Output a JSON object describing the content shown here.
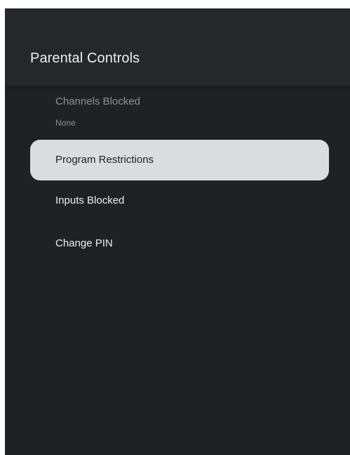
{
  "screen": {
    "title": "Parental Controls"
  },
  "menu": {
    "channels_blocked": {
      "label": "Channels Blocked",
      "value": "None"
    },
    "program_restrictions": {
      "label": "Program Restrictions"
    },
    "inputs_blocked": {
      "label": "Inputs Blocked"
    },
    "change_pin": {
      "label": "Change PIN"
    }
  },
  "colors": {
    "background": "#202124",
    "header": "#26272a",
    "focus_highlight": "#dadce0",
    "text_primary": "#eceef0",
    "text_disabled": "#8d9095"
  }
}
